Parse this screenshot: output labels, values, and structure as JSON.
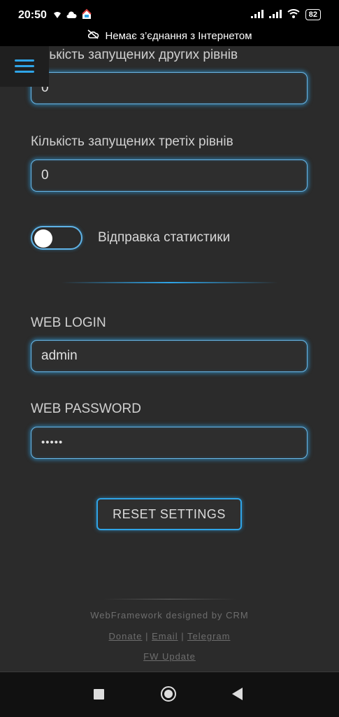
{
  "status_bar": {
    "time": "20:50",
    "battery": "82"
  },
  "offline_banner": {
    "text": "Немає з’єднання з Інтернетом"
  },
  "form": {
    "second_levels": {
      "label": "Кількість запущених других рівнів",
      "value": "0"
    },
    "third_levels": {
      "label": "Кількість запущених третіх рівнів",
      "value": "0"
    },
    "statistics_toggle": {
      "label": "Відправка статистики",
      "enabled": false
    },
    "web_login": {
      "label": "WEB LOGIN",
      "value": "admin"
    },
    "web_password": {
      "label": "WEB PASSWORD",
      "value": "•••••"
    },
    "reset_button": "RESET SETTINGS"
  },
  "footer": {
    "credit": "WebFramework designed by CRM",
    "links": {
      "donate": "Donate",
      "email": "Email",
      "telegram": "Telegram",
      "separator": "|"
    },
    "fw_update": "FW Update"
  },
  "colors": {
    "accent": "#2fa4e7",
    "background": "#2b2b2b"
  }
}
